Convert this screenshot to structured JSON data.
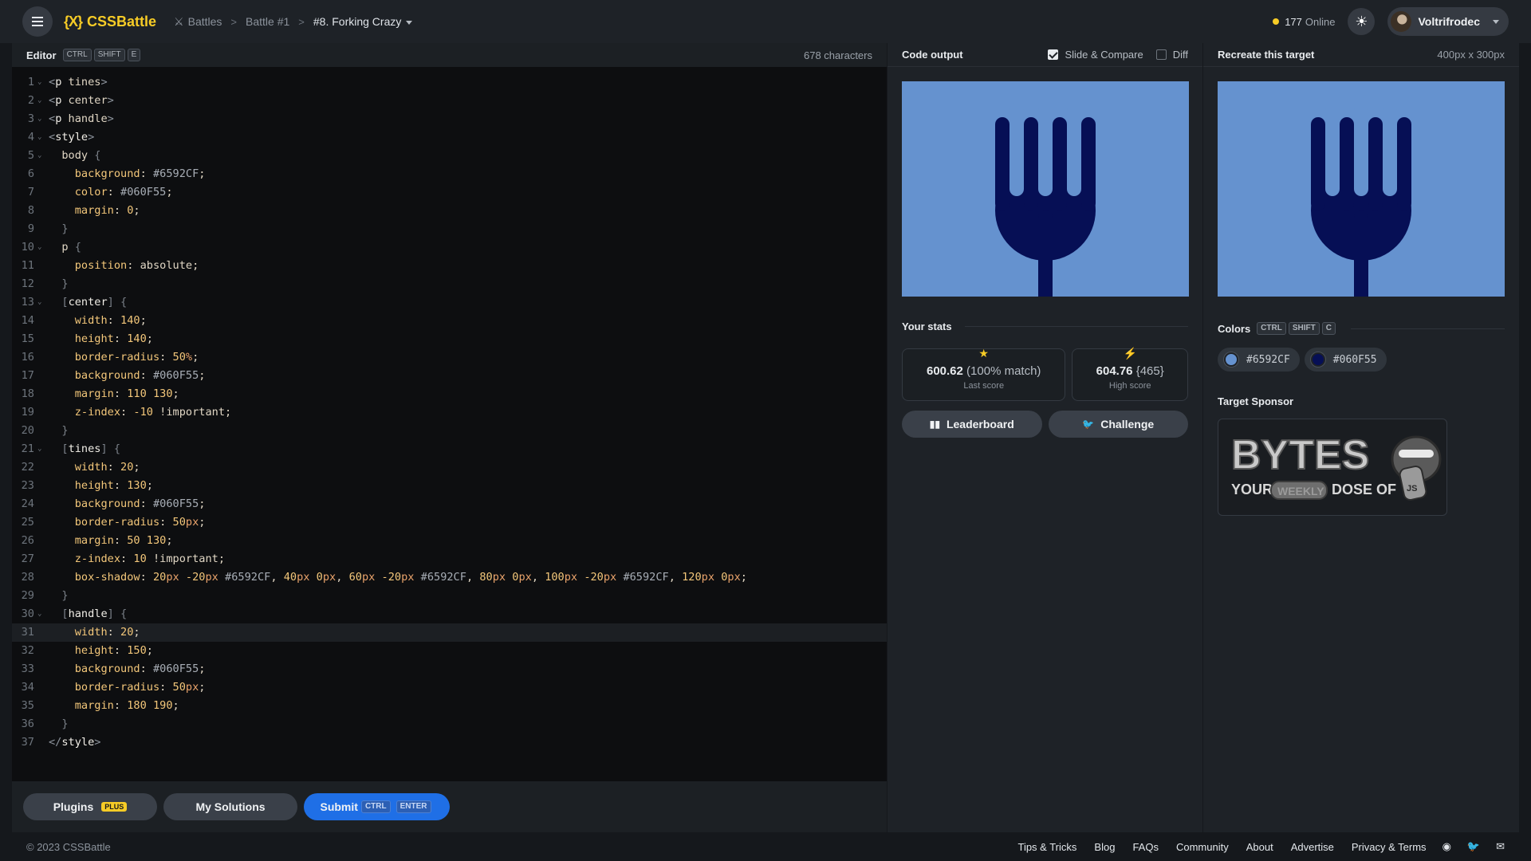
{
  "header": {
    "logo": "CSSBattle",
    "logo_mark": "{X}",
    "crumbs": [
      "Battles",
      "Battle #1",
      "#8. Forking Crazy"
    ],
    "online_count": "177",
    "online_label": "Online",
    "username": "Voltrifrodec"
  },
  "editor": {
    "title": "Editor",
    "shortcut": [
      "CTRL",
      "SHIFT",
      "E"
    ],
    "char_count": "678 characters",
    "active_line": 31
  },
  "editor_footer": {
    "plugins_label": "Plugins",
    "plus_badge": "PLUS",
    "solutions_label": "My Solutions",
    "submit_label": "Submit",
    "submit_keys": [
      "CTRL",
      "ENTER"
    ]
  },
  "output": {
    "title": "Code output",
    "slide_compare_label": "Slide & Compare",
    "slide_compare_checked": true,
    "diff_label": "Diff",
    "diff_checked": false,
    "stats_title": "Your stats",
    "last_score_value": "600.62",
    "last_score_match": "(100% match)",
    "last_score_label": "Last score",
    "high_score_value": "604.76",
    "high_score_extra": "{465}",
    "high_score_label": "High score",
    "leaderboard_label": "Leaderboard",
    "challenge_label": "Challenge"
  },
  "target": {
    "title": "Recreate this target",
    "size": "400px x 300px",
    "colors_title": "Colors",
    "colors_shortcut": [
      "CTRL",
      "SHIFT",
      "C"
    ],
    "colors": [
      "#6592CF",
      "#060F55"
    ],
    "sponsor_title": "Target Sponsor",
    "sponsor_brand": "BYTES",
    "sponsor_tagline_left": "YOUR",
    "sponsor_tagline_mid": "WEEKLY",
    "sponsor_tagline_right": "DOSE OF",
    "sponsor_badge": "JS"
  },
  "footer": {
    "copyright": "© 2023 CSSBattle",
    "links": [
      "Tips & Tricks",
      "Blog",
      "FAQs",
      "Community",
      "About",
      "Advertise",
      "Privacy & Terms"
    ],
    "icons": [
      "discord-icon",
      "twitter-icon",
      "mail-icon"
    ]
  },
  "colors": {
    "accent": "#f7cc26",
    "submit": "#1f6fe6",
    "canvas_bg": "#6592CF",
    "fork": "#060F55"
  },
  "code_lines": [
    "<p tines>",
    "<p center>",
    "<p handle>",
    "<style>",
    "  body {",
    "    background: #6592CF;",
    "    color: #060F55;",
    "    margin: 0;",
    "  }",
    "  p {",
    "    position: absolute;",
    "  }",
    "  [center] {",
    "    width: 140;",
    "    height: 140;",
    "    border-radius: 50%;",
    "    background: #060F55;",
    "    margin: 110 130;",
    "    z-index: -10 !important;",
    "  }",
    "  [tines] {",
    "    width: 20;",
    "    height: 130;",
    "    background: #060F55;",
    "    border-radius: 50px;",
    "    margin: 50 130;",
    "    z-index: 10 !important;",
    "    box-shadow: 20px -20px #6592CF, 40px 0px, 60px -20px #6592CF, 80px 0px, 100px -20px #6592CF, 120px 0px;",
    "  }",
    "  [handle] {",
    "    width: 20;",
    "    height: 150;",
    "    background: #060F55;",
    "    border-radius: 50px;",
    "    margin: 180 190;",
    "  }",
    "</style>"
  ],
  "fold_lines": [
    1,
    2,
    3,
    4,
    5,
    10,
    13,
    21,
    30
  ]
}
